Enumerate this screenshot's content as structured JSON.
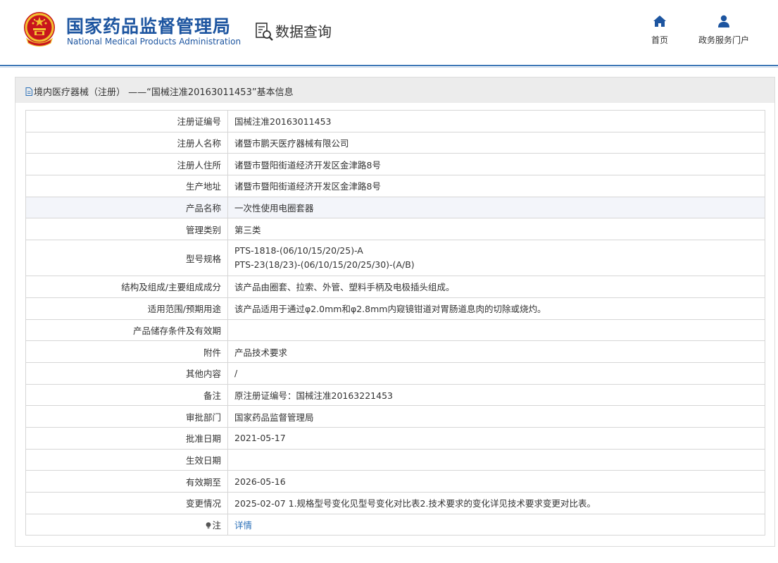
{
  "header": {
    "agency_cn": "国家药品监督管理局",
    "agency_en": "National Medical Products Administration",
    "query_title": "数据查询",
    "nav": [
      {
        "label": "首页",
        "icon": "home-icon"
      },
      {
        "label": "政务服务门户",
        "icon": "user-icon"
      }
    ]
  },
  "panel": {
    "title": "境内医疗器械（注册） ——“国械注准20163011453”基本信息"
  },
  "rows": [
    {
      "key": "注册证编号",
      "value": "国械注准20163011453"
    },
    {
      "key": "注册人名称",
      "value": "诸暨市鹏天医疗器械有限公司"
    },
    {
      "key": "注册人住所",
      "value": "诸暨市暨阳街道经济开发区金津路8号"
    },
    {
      "key": "生产地址",
      "value": "诸暨市暨阳街道经济开发区金津路8号"
    },
    {
      "key": "产品名称",
      "value": "一次性使用电圈套器"
    },
    {
      "key": "管理类别",
      "value": "第三类"
    },
    {
      "key": "型号规格",
      "value_lines": [
        "PTS-1818-(06/10/15/20/25)-A",
        "PTS-23(18/23)-(06/10/15/20/25/30)-(A/B)"
      ]
    },
    {
      "key": "结构及组成/主要组成成分",
      "value": "该产品由圈套、拉索、外管、塑料手柄及电极插头组成。"
    },
    {
      "key": "适用范围/预期用途",
      "value": "该产品适用于通过φ2.0mm和φ2.8mm内窥镜钳道对胃肠道息肉的切除或烧灼。"
    },
    {
      "key": "产品储存条件及有效期",
      "value": ""
    },
    {
      "key": "附件",
      "value": "产品技术要求"
    },
    {
      "key": "其他内容",
      "value": "/"
    },
    {
      "key": "备注",
      "value": "原注册证编号：国械注准20163221453"
    },
    {
      "key": "审批部门",
      "value": "国家药品监督管理局"
    },
    {
      "key": "批准日期",
      "value": "2021-05-17"
    },
    {
      "key": "生效日期",
      "value": ""
    },
    {
      "key": "有效期至",
      "value": "2026-05-16"
    },
    {
      "key": "变更情况",
      "value": "2025-02-07 1.规格型号变化见型号变化对比表2.技术要求的变化详见技术要求变更对比表。"
    },
    {
      "key": "注",
      "value": "详情",
      "icon": "bulb-icon"
    }
  ],
  "colors": {
    "brand_blue": "#1d55a0",
    "link_blue": "#2a6fb8",
    "header_rule": "#3d77b6",
    "highlight_row": "#f3f5fa"
  }
}
